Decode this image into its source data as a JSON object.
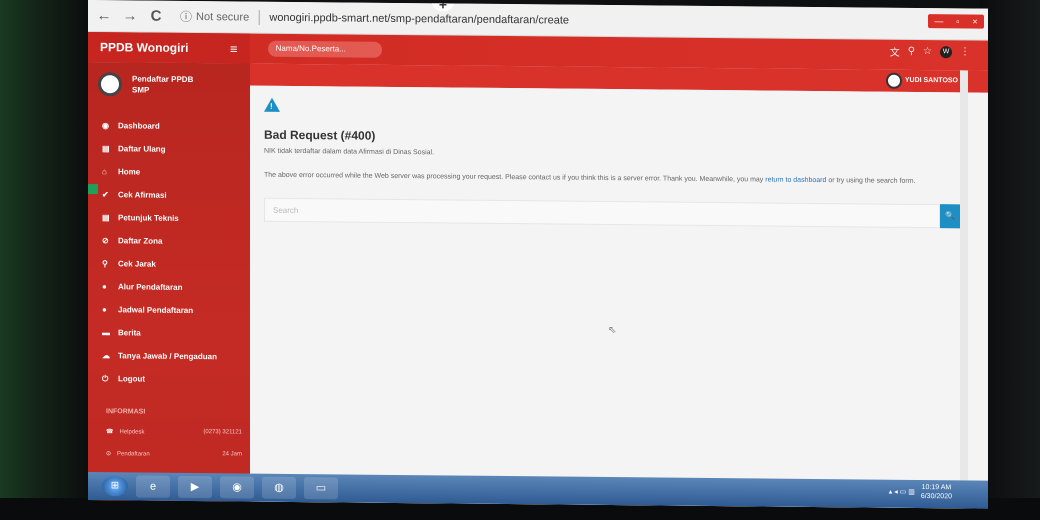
{
  "browser": {
    "back": "←",
    "forward": "→",
    "reload": "C",
    "info_icon": "ⓘ",
    "security": "Not secure",
    "url": "wonogiri.ppdb-smart.net/smp-pendaftaran/pendaftaran/create",
    "new_tab": "+",
    "win_controls": [
      "—",
      "▫",
      "×"
    ],
    "icons": [
      "translate-icon",
      "search-icon",
      "star-icon"
    ],
    "profile_initial": "W"
  },
  "header": {
    "brand": "PPDB Wonogiri",
    "menu_icon": "≡",
    "search_placeholder": "Nama/No.Peserta...",
    "user_name": "YUDI SANTOSO"
  },
  "sidebar": {
    "profile_name": "Pendaftar PPDB SMP",
    "items": [
      {
        "icon": "◉",
        "label": "Dashboard"
      },
      {
        "icon": "▤",
        "label": "Daftar Ulang"
      },
      {
        "icon": "⌂",
        "label": "Home"
      },
      {
        "icon": "✔",
        "label": "Cek Afirmasi"
      },
      {
        "icon": "▤",
        "label": "Petunjuk Teknis"
      },
      {
        "icon": "⊘",
        "label": "Daftar Zona"
      },
      {
        "icon": "⚲",
        "label": "Cek Jarak"
      },
      {
        "icon": "●",
        "label": "Alur Pendaftaran"
      },
      {
        "icon": "●",
        "label": "Jadwal Pendaftaran"
      },
      {
        "icon": "▬",
        "label": "Berita"
      },
      {
        "icon": "☁",
        "label": "Tanya Jawab / Pengaduan"
      },
      {
        "icon": "⏻",
        "label": "Logout"
      }
    ],
    "info_heading": "INFORMASI",
    "info": [
      {
        "icon": "☎",
        "label": "Helpdesk",
        "value": "(0273) 321121"
      },
      {
        "icon": "⊙",
        "label": "Pendaftaran",
        "value": "24 Jam"
      }
    ]
  },
  "main": {
    "error_title": "Bad Request (#400)",
    "error_message": "NIK tidak terdaftar dalam data Afirmasi di Dinas Sosial.",
    "desc_before": "The above error occurred while the Web server was processing your request. Please contact us if you think this is a server error. Thank you. Meanwhile, you may ",
    "desc_link": "return to dashboard",
    "desc_after": " or try using the search form.",
    "search_placeholder": "Search",
    "search_button": "🔍"
  },
  "taskbar": {
    "time": "10:19 AM",
    "date": "6/30/2020"
  },
  "colors": {
    "brand_red": "#d9322b",
    "sidebar_red": "#c42b24",
    "accent_blue": "#1d8fc4"
  }
}
